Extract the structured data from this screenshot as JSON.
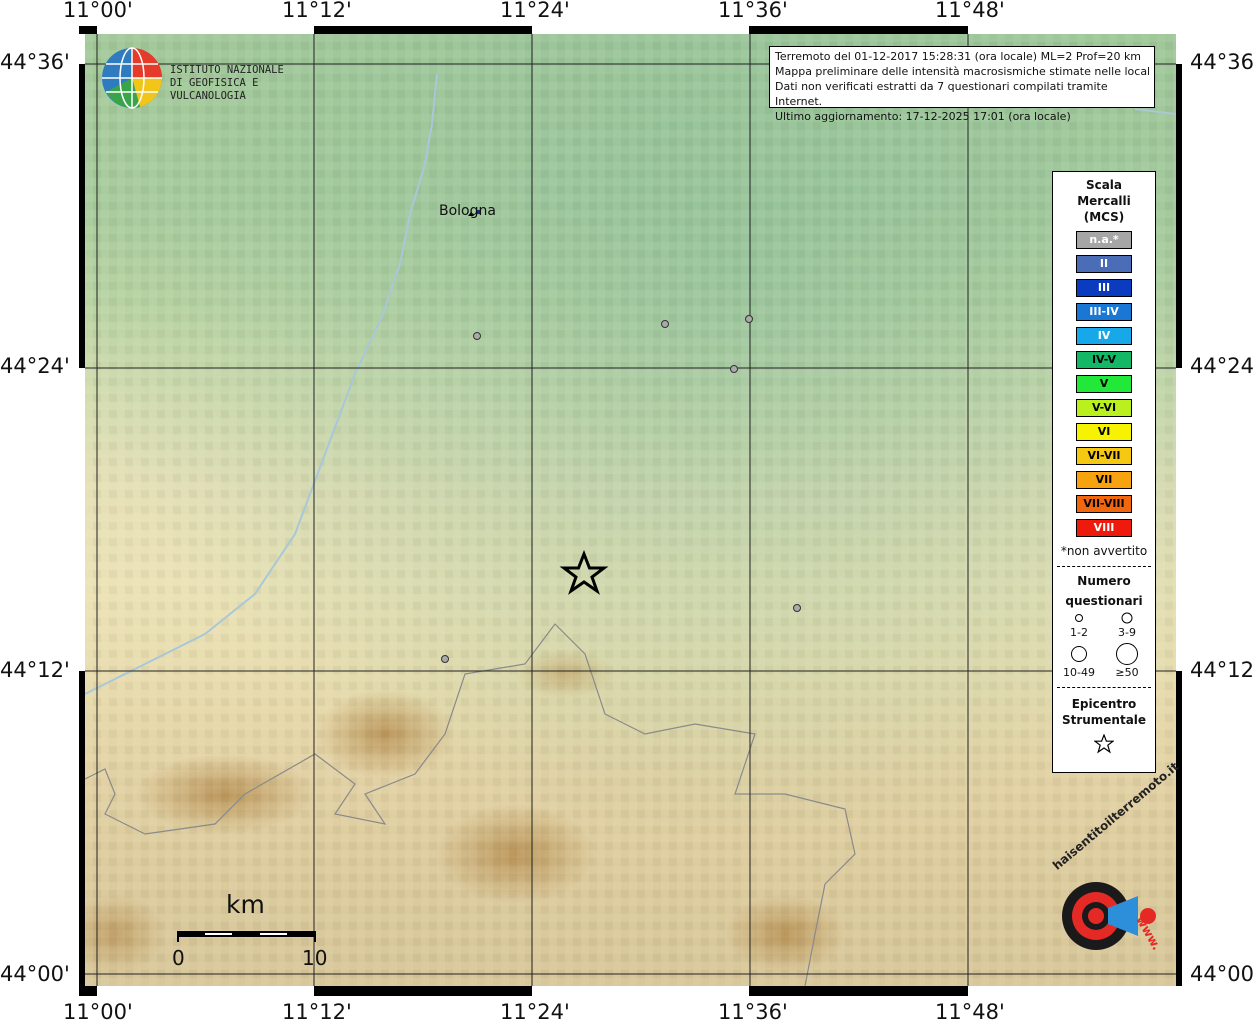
{
  "map": {
    "lon_labels": [
      "11°00'",
      "11°12'",
      "11°24'",
      "11°36'",
      "11°48'"
    ],
    "lat_labels": [
      "44°36'",
      "44°24'",
      "44°12'",
      "44°00'"
    ],
    "city": "Bologna"
  },
  "info": {
    "line1": "Terremoto del 01-12-2017 15:28:31 (ora locale) ML=2 Prof=20 km",
    "line2": "Mappa preliminare delle intensità macrosismiche stimate nelle località",
    "line3": "Dati non verificati estratti da 7 questionari compilati tramite Internet.",
    "line4": "Ultimo aggiornamento: 17-12-2025 17:01 (ora locale)"
  },
  "legend": {
    "title1": "Scala",
    "title2": "Mercalli",
    "title3": "(MCS)",
    "scale": [
      {
        "label": "n.a.*",
        "color": "#a6a6a6",
        "text": "#ffffff"
      },
      {
        "label": "II",
        "color": "#4b6cb7",
        "text": "#ffffff"
      },
      {
        "label": "III",
        "color": "#0b3bbf",
        "text": "#ffffff"
      },
      {
        "label": "III-IV",
        "color": "#1a78d4",
        "text": "#ffffff"
      },
      {
        "label": "IV",
        "color": "#16a8e8",
        "text": "#ffffff"
      },
      {
        "label": "IV-V",
        "color": "#14b766",
        "text": "#000000"
      },
      {
        "label": "V",
        "color": "#22e83a",
        "text": "#000000"
      },
      {
        "label": "V-VI",
        "color": "#b9f01e",
        "text": "#000000"
      },
      {
        "label": "VI",
        "color": "#f7f200",
        "text": "#000000"
      },
      {
        "label": "VI-VII",
        "color": "#f5c812",
        "text": "#000000"
      },
      {
        "label": "VII",
        "color": "#f7a20f",
        "text": "#000000"
      },
      {
        "label": "VII-VIII",
        "color": "#f2660d",
        "text": "#000000"
      },
      {
        "label": "VIII",
        "color": "#ee1b0d",
        "text": "#ffffff"
      }
    ],
    "not_felt": "*non avvertito",
    "count_title1": "Numero",
    "count_title2": "questionari",
    "count_1": "1-2",
    "count_2": "3-9",
    "count_3": "10-49",
    "count_4": "≥50",
    "epi_title1": "Epicentro",
    "epi_title2": "Strumentale"
  },
  "logo": {
    "ingv_line1": "ISTITUTO NAZIONALE",
    "ingv_line2": "DI GEOFISICA E VULCANOLOGIA",
    "hai_text": "haisentitoilterremoto.it",
    "hai_www": "www."
  },
  "scalebar": {
    "unit": "km",
    "start": "0",
    "end": "10"
  }
}
